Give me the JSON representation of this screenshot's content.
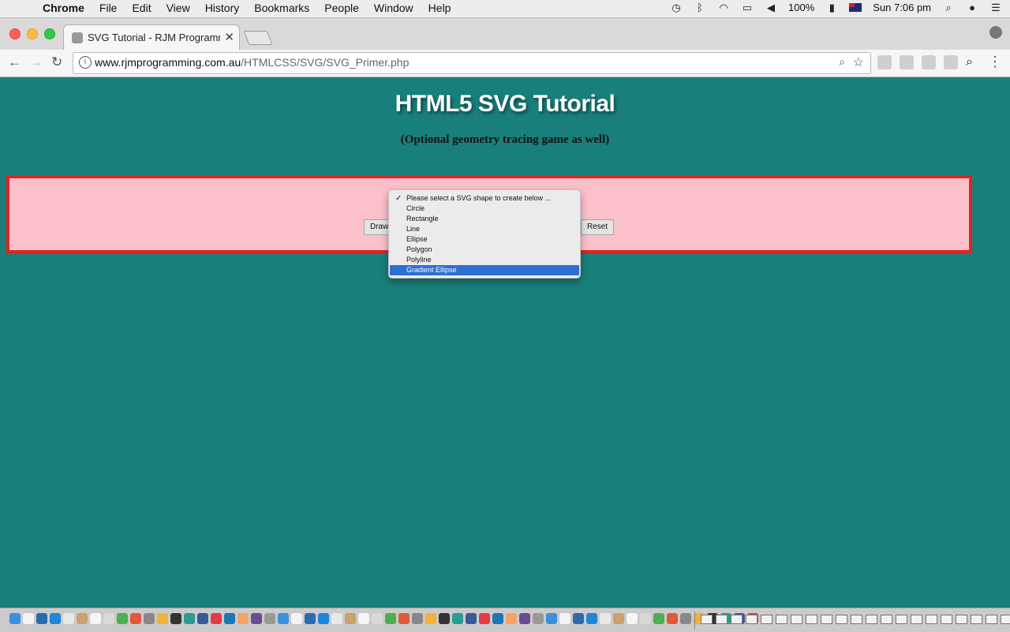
{
  "menubar": {
    "app": "Chrome",
    "items": [
      "File",
      "Edit",
      "View",
      "History",
      "Bookmarks",
      "People",
      "Window",
      "Help"
    ],
    "battery": "100%",
    "clock": "Sun 7:06 pm"
  },
  "browser": {
    "tab_title": "SVG Tutorial - RJM Programmi",
    "url_domain": "www.rjmprogramming.com.au",
    "url_path": "/HTMLCSS/SVG/SVG_Primer.php"
  },
  "page": {
    "title": "HTML5 SVG Tutorial",
    "subtitle": "(Optional geometry tracing game as well)",
    "draw_label": "Draw",
    "reset_label": "Reset"
  },
  "dropdown": {
    "options": [
      "Please select a SVG shape to create below ...",
      "Circle",
      "Rectangle",
      "Line",
      "Ellipse",
      "Polygon",
      "Polyline",
      "Gradient Ellipse"
    ],
    "checked_index": 0,
    "highlighted": "Gradient Ellipse"
  },
  "colors": {
    "page_bg": "#197f7b",
    "panel_bg": "#fcc0cb",
    "panel_border": "#e0231f",
    "highlight": "#2e6fd3"
  }
}
